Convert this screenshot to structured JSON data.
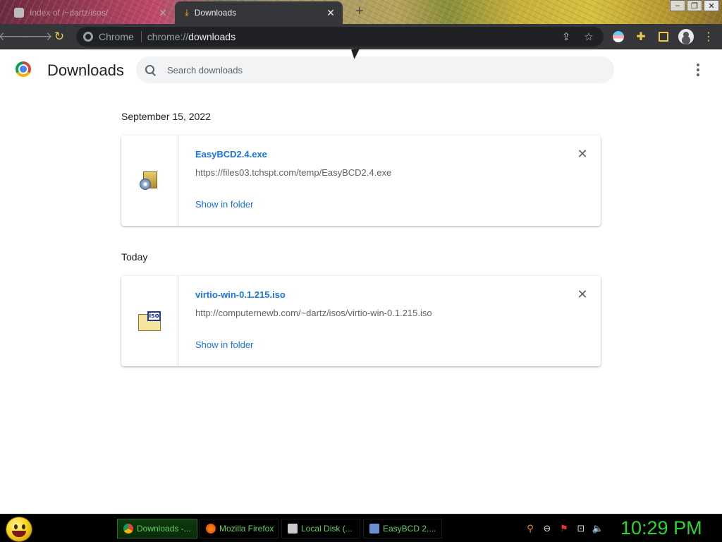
{
  "browser": {
    "tabs": [
      {
        "title": "Index of /~dartz/isos/",
        "active": false
      },
      {
        "title": "Downloads",
        "active": true
      }
    ],
    "omnibox": {
      "chip": "Chrome",
      "url_prefix": "chrome://",
      "url_host": "downloads"
    }
  },
  "page": {
    "title": "Downloads",
    "search_placeholder": "Search downloads"
  },
  "groups": [
    {
      "date": "September 15, 2022",
      "items": [
        {
          "filename": "EasyBCD2.4.exe",
          "url": "https://files03.tchspt.com/temp/EasyBCD2.4.exe",
          "action": "Show in folder",
          "icon": "exe-installer-icon"
        }
      ]
    },
    {
      "date": "Today",
      "items": [
        {
          "filename": "virtio-win-0.1.215.iso",
          "url": "http://computernewb.com/~dartz/isos/virtio-win-0.1.215.iso",
          "action": "Show in folder",
          "icon": "iso-file-icon"
        }
      ]
    }
  ],
  "taskbar": {
    "tasks": [
      {
        "label": "Downloads -...",
        "icon": "chrome-icon",
        "active": true
      },
      {
        "label": "Mozilla Firefox",
        "icon": "firefox-icon",
        "active": false
      },
      {
        "label": "Local Disk (...",
        "icon": "drive-icon",
        "active": false
      },
      {
        "label": "EasyBCD 2....",
        "icon": "easybcd-icon",
        "active": false
      }
    ],
    "clock": "10:29 PM"
  },
  "colors": {
    "accent": "#1a73e8",
    "toolbar": "#35363a",
    "clock": "#2bd62b"
  }
}
